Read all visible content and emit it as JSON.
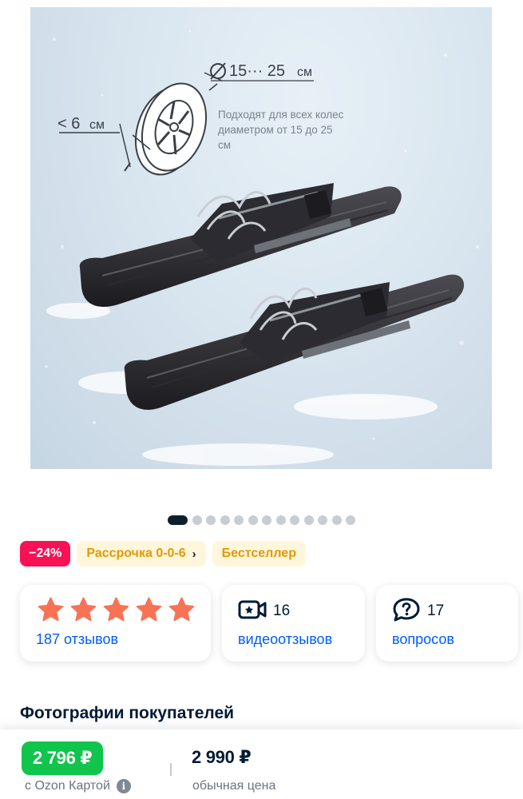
{
  "product_image": {
    "alt": "",
    "wheel_diameter_text": "15··· 25",
    "wheel_diameter_unit": "см",
    "width_text": "< 6",
    "width_unit": "см",
    "caption_line1": "Подходят для всех колес",
    "caption_line2": "диаметром от 15 до 25",
    "caption_line3": "см"
  },
  "gallery": {
    "total": 13,
    "active_index": 0
  },
  "badges": {
    "discount": "−24%",
    "installment": "Рассрочка 0-0-6",
    "installment_chevron": "›",
    "bestseller": "Бестселлер"
  },
  "colors": {
    "star": "#f87355",
    "discount": "#f91155",
    "ozon_price": "#10c44c",
    "link": "#005bff",
    "badge_text": "#e59800"
  },
  "reviews_card": {
    "rating": 5,
    "link": "187 отзывов"
  },
  "videos_card": {
    "icon": "video-review-icon",
    "count": "16",
    "link": "видеоотзывов"
  },
  "questions_card": {
    "icon": "question-bubble-icon",
    "count": "17",
    "link": "вопросов"
  },
  "section": {
    "buyer_photos_title": "Фотографии покупателей"
  },
  "price_bar": {
    "ozon_price": "2 796 ₽",
    "ozon_card_label": "с Ozon Картой",
    "info_icon": "i",
    "regular_price": "2 990 ₽",
    "regular_label": "обычная цена"
  }
}
